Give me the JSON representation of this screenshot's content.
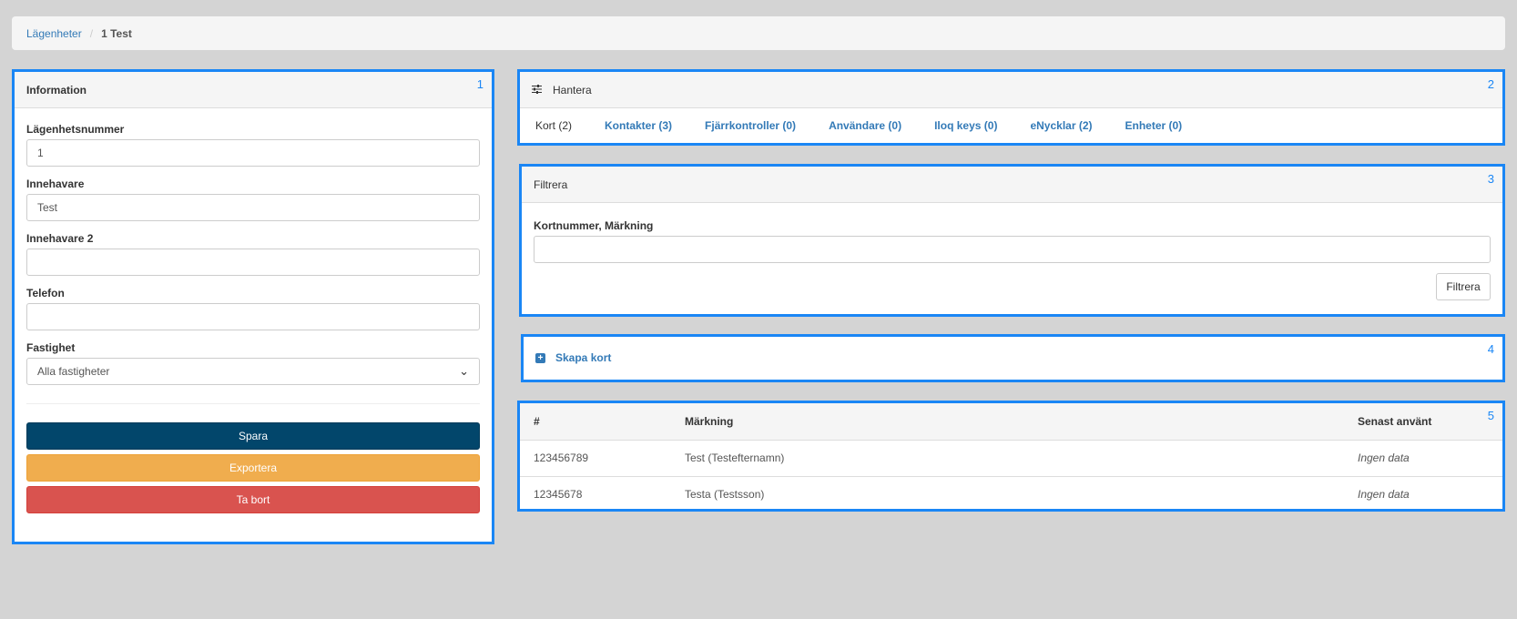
{
  "breadcrumb": {
    "parent": "Lägenheter",
    "separator": "/",
    "current": "1 Test"
  },
  "info_panel": {
    "number": "1",
    "title": "Information",
    "fields": [
      {
        "label": "Lägenhetsnummer",
        "value": "1"
      },
      {
        "label": "Innehavare",
        "value": "Test"
      },
      {
        "label": "Innehavare 2",
        "value": ""
      },
      {
        "label": "Telefon",
        "value": ""
      }
    ],
    "property": {
      "label": "Fastighet",
      "selected": "Alla fastigheter"
    },
    "buttons": {
      "save": "Spara",
      "export": "Exportera",
      "delete": "Ta bort"
    }
  },
  "manage_panel": {
    "number": "2",
    "title": "Hantera",
    "icon": "sliders-icon",
    "tabs": [
      {
        "label": "Kort (2)",
        "active": true
      },
      {
        "label": "Kontakter (3)",
        "active": false
      },
      {
        "label": "Fjärrkontroller (0)",
        "active": false
      },
      {
        "label": "Användare (0)",
        "active": false
      },
      {
        "label": "Iloq keys (0)",
        "active": false
      },
      {
        "label": "eNycklar (2)",
        "active": false
      },
      {
        "label": "Enheter (0)",
        "active": false
      }
    ]
  },
  "filter_panel": {
    "number": "3",
    "title": "Filtrera",
    "field_label": "Kortnummer, Märkning",
    "field_value": "",
    "button": "Filtrera"
  },
  "create_panel": {
    "number": "4",
    "label": "Skapa kort",
    "icon": "plus-square-icon"
  },
  "table_panel": {
    "number": "5",
    "headers": [
      "#",
      "Märkning",
      "Senast använt"
    ],
    "rows": [
      [
        "123456789",
        "Test (Testefternamn)",
        "Ingen data"
      ],
      [
        "12345678",
        "Testa (Testsson)",
        "Ingen data"
      ]
    ]
  },
  "colors": {
    "highlight_border": "#1a86f5",
    "primary": "#02466b",
    "warning": "#f0ad4e",
    "danger": "#d9534f",
    "link": "#337ab7"
  }
}
